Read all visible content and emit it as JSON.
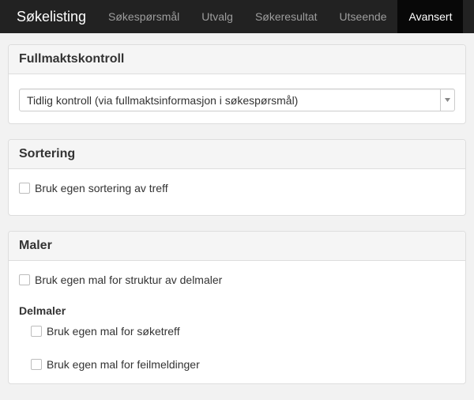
{
  "navbar": {
    "brand": "Søkelisting",
    "tabs": [
      {
        "label": "Søkespørsmål"
      },
      {
        "label": "Utvalg"
      },
      {
        "label": "Søkeresultat"
      },
      {
        "label": "Utseende"
      },
      {
        "label": "Avansert",
        "active": true
      }
    ]
  },
  "panels": {
    "fullmakt": {
      "title": "Fullmaktskontroll",
      "select_value": "Tidlig kontroll (via fullmaktsinformasjon i søkespørsmål)"
    },
    "sortering": {
      "title": "Sortering",
      "checkbox_label": "Bruk egen sortering av treff"
    },
    "maler": {
      "title": "Maler",
      "checkbox_label": "Bruk egen mal for struktur av delmaler",
      "delmaler_heading": "Delmaler",
      "sub_checkboxes": [
        {
          "label": "Bruk egen mal for søketreff"
        },
        {
          "label": "Bruk egen mal for feilmeldinger"
        }
      ]
    }
  },
  "colors": {
    "navbar_bg": "#222222",
    "active_tab_bg": "#080808",
    "panel_heading_bg": "#f5f5f5",
    "page_bg": "#f2f2f2"
  }
}
